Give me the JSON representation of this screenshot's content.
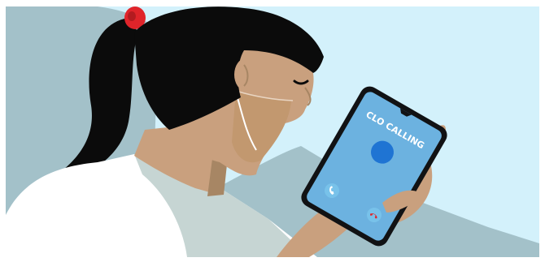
{
  "scene": {
    "caller_label": "CLO CALLING",
    "colors": {
      "sky": "#d3f1fb",
      "hill": "#a3c1c9",
      "hair": "#0b0b0b",
      "hair_tie": "#e0242a",
      "skin": "#c9a07e",
      "skin_shadow": "#a78664",
      "mask": "#c9a07e",
      "shirt": "#ffffff",
      "shirt_shadow": "#c6d5d3",
      "phone_body": "#111214",
      "phone_screen": "#6cb2e0",
      "caller_avatar": "#1f74d3",
      "accept_icon": "#ffffff",
      "decline_icon": "#ffffff"
    },
    "icons": [
      "accept-call-icon",
      "decline-call-icon"
    ]
  }
}
